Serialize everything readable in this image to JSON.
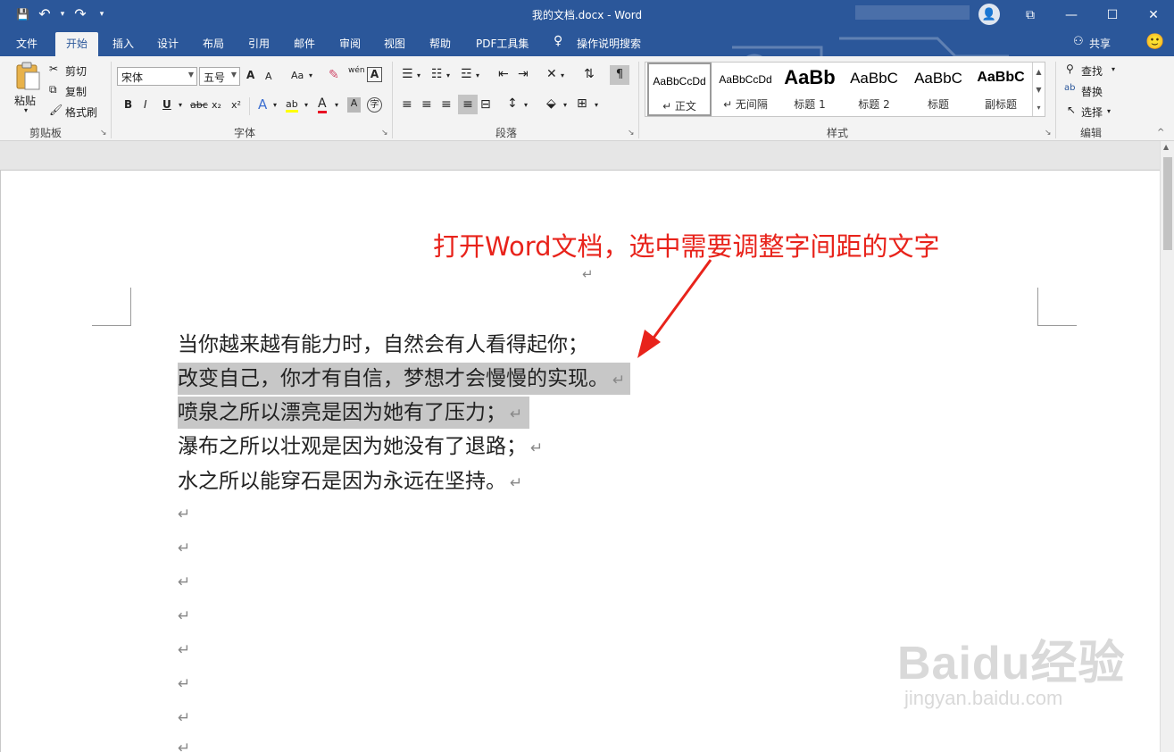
{
  "window": {
    "title": "我的文档.docx  -  Word",
    "controls": {
      "ribbon_display": "⧉",
      "minimize": "—",
      "maximize": "☐",
      "close": "✕"
    },
    "qat": {
      "save": "💾",
      "undo": "↶",
      "undo_caret": "▾",
      "redo": "↷",
      "customize": "▾"
    },
    "avatar_glyph": "👤"
  },
  "tabs": [
    "文件",
    "开始",
    "插入",
    "设计",
    "布局",
    "引用",
    "邮件",
    "审阅",
    "视图",
    "帮助",
    "PDF工具集"
  ],
  "active_tab": "开始",
  "tell_me": {
    "icon": "lightbulb-icon",
    "label": "操作说明搜索"
  },
  "share": {
    "label": "共享",
    "icon": "person-icon"
  },
  "feedback_icon": "🙂",
  "ribbon": {
    "clipboard": {
      "paste": "粘贴",
      "cut": "剪切",
      "copy": "复制",
      "format_painter": "格式刷",
      "label": "剪贴板"
    },
    "font": {
      "font_name": "宋体",
      "font_size": "五号",
      "grow": "A",
      "shrink": "A",
      "change_case": "Aa",
      "bold": "B",
      "italic": "I",
      "underline": "U",
      "strike": "abc",
      "subscript": "x₂",
      "superscript": "x²",
      "text_effects": "A",
      "highlight": "ab",
      "font_color": "A",
      "char_shading": "A",
      "enclose": "字",
      "phonetic": "wén",
      "char_border": "A",
      "label": "字体"
    },
    "paragraph": {
      "label": "段落"
    },
    "styles": {
      "label": "样式",
      "items": [
        {
          "sample": "AaBbCcDd",
          "name": "↵ 正文"
        },
        {
          "sample": "AaBbCcDd",
          "name": "↵ 无间隔"
        },
        {
          "sample": "AaBb",
          "name": "标题 1"
        },
        {
          "sample": "AaBbC",
          "name": "标题 2"
        },
        {
          "sample": "AaBbC",
          "name": "标题"
        },
        {
          "sample": "AaBbC",
          "name": "副标题"
        }
      ]
    },
    "editing": {
      "find": "查找",
      "replace": "替换",
      "select": "选择",
      "label": "编辑"
    }
  },
  "annotation": "打开Word文档，选中需要调整字间距的文字",
  "document": {
    "top_mark": "↵",
    "lines": [
      {
        "text": "当你越来越有能力时，自然会有人看得起你；",
        "mark": "",
        "selected": false
      },
      {
        "text": "改变自己，你才有自信，梦想才会慢慢的实现。",
        "mark": "↵",
        "selected": true
      },
      {
        "text": "喷泉之所以漂亮是因为她有了压力；",
        "mark": "↵",
        "selected": true
      },
      {
        "text": "瀑布之所以壮观是因为她没有了退路；",
        "mark": "↵",
        "selected": false
      },
      {
        "text": "水之所以能穿石是因为永远在坚持。",
        "mark": "↵",
        "selected": false
      }
    ],
    "empty_marks": [
      "↵",
      "↵",
      "↵",
      "↵",
      "↵",
      "↵",
      "↵",
      "↵"
    ]
  },
  "watermark": {
    "main": "Baidu经验",
    "sub": "jingyan.baidu.com"
  },
  "colors": {
    "accent": "#2b579a",
    "annotation": "#e8231b",
    "selection": "#c7c7c7"
  }
}
